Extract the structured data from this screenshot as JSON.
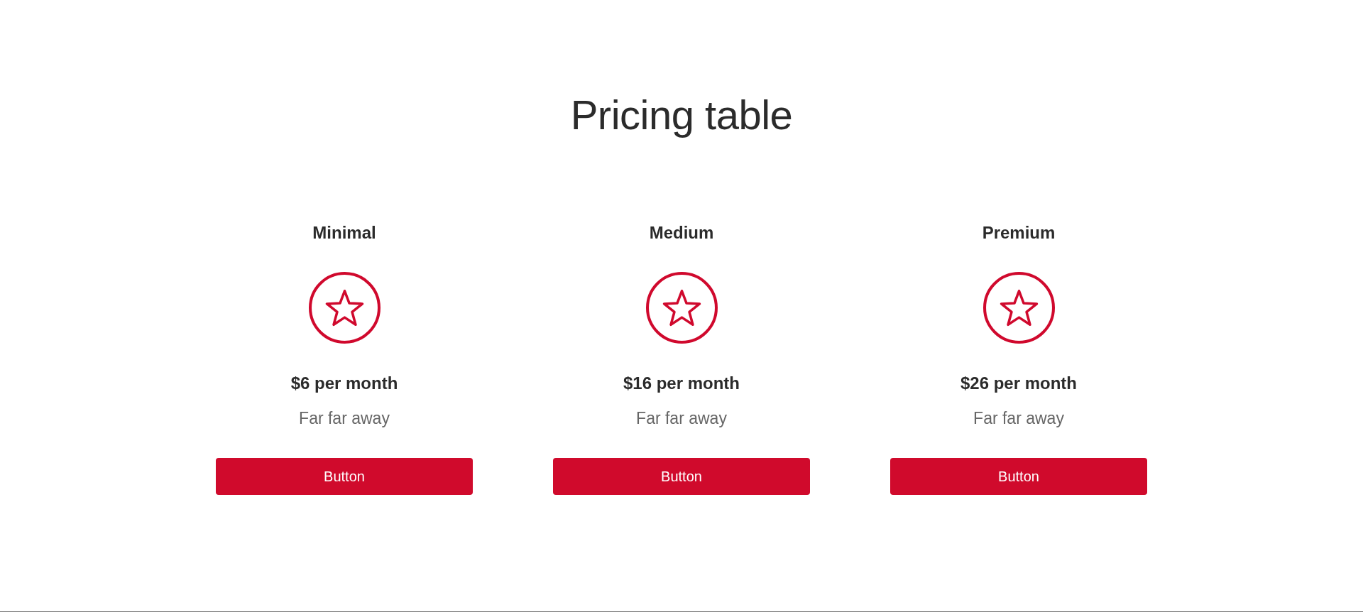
{
  "title": "Pricing table",
  "plans": [
    {
      "name": "Minimal",
      "price": "$6 per month",
      "description": "Far far away",
      "button": "Button"
    },
    {
      "name": "Medium",
      "price": "$16 per month",
      "description": "Far far away",
      "button": "Button"
    },
    {
      "name": "Premium",
      "price": "$26 per month",
      "description": "Far far away",
      "button": "Button"
    }
  ]
}
